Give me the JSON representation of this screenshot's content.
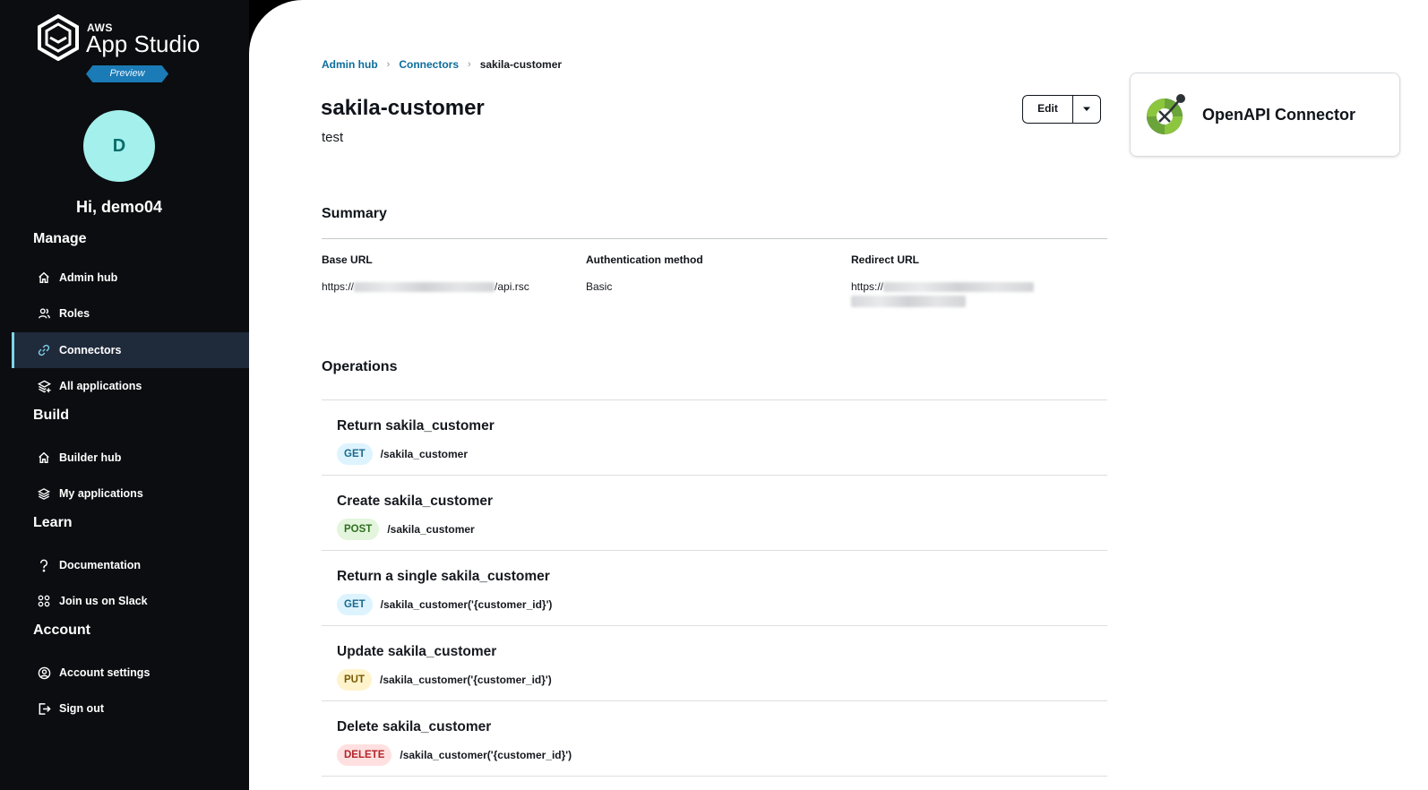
{
  "brand": {
    "aws": "AWS",
    "app_name": "App Studio",
    "preview": "Preview"
  },
  "user": {
    "initial": "D",
    "greeting": "Hi, demo04"
  },
  "sidebar": {
    "sections": [
      {
        "label": "Manage",
        "items": [
          {
            "label": "Admin hub",
            "icon": "home-icon"
          },
          {
            "label": "Roles",
            "icon": "users-icon"
          },
          {
            "label": "Connectors",
            "icon": "link-icon",
            "active": true
          },
          {
            "label": "All applications",
            "icon": "layers-plus-icon"
          }
        ]
      },
      {
        "label": "Build",
        "items": [
          {
            "label": "Builder hub",
            "icon": "home-icon"
          },
          {
            "label": "My applications",
            "icon": "layers-icon"
          }
        ]
      },
      {
        "label": "Learn",
        "items": [
          {
            "label": "Documentation",
            "icon": "question-icon"
          },
          {
            "label": "Join us on Slack",
            "icon": "slack-icon"
          }
        ]
      },
      {
        "label": "Account",
        "items": [
          {
            "label": "Account settings",
            "icon": "user-circle-icon"
          },
          {
            "label": "Sign out",
            "icon": "sign-out-icon"
          }
        ]
      }
    ]
  },
  "breadcrumb": [
    "Admin hub",
    "Connectors",
    "sakila-customer"
  ],
  "page": {
    "title": "sakila-customer",
    "description": "test",
    "edit_label": "Edit"
  },
  "connector_card": {
    "title": "OpenAPI Connector"
  },
  "summary": {
    "heading": "Summary",
    "fields": [
      {
        "label": "Base URL",
        "value_prefix": "https://",
        "value_suffix": "/api.rsc"
      },
      {
        "label": "Authentication method",
        "value": "Basic"
      },
      {
        "label": "Redirect URL",
        "value_prefix": "https://"
      }
    ]
  },
  "operations": {
    "heading": "Operations",
    "items": [
      {
        "title": "Return sakila_customer",
        "method": "GET",
        "path": "/sakila_customer"
      },
      {
        "title": "Create sakila_customer",
        "method": "POST",
        "path": "/sakila_customer"
      },
      {
        "title": "Return a single sakila_customer",
        "method": "GET",
        "path": "/sakila_customer('{customer_id}')"
      },
      {
        "title": "Update sakila_customer",
        "method": "PUT",
        "path": "/sakila_customer('{customer_id}')"
      },
      {
        "title": "Delete sakila_customer",
        "method": "DELETE",
        "path": "/sakila_customer('{customer_id}')"
      }
    ]
  },
  "colors": {
    "GET": {
      "bg": "#ddf4ff",
      "fg": "#1d6a8c"
    },
    "POST": {
      "bg": "#e3f5dc",
      "fg": "#2f6f1f"
    },
    "PUT": {
      "bg": "#fff3cc",
      "fg": "#7a5a00"
    },
    "DELETE": {
      "bg": "#ffe0e0",
      "fg": "#b3262b"
    }
  }
}
